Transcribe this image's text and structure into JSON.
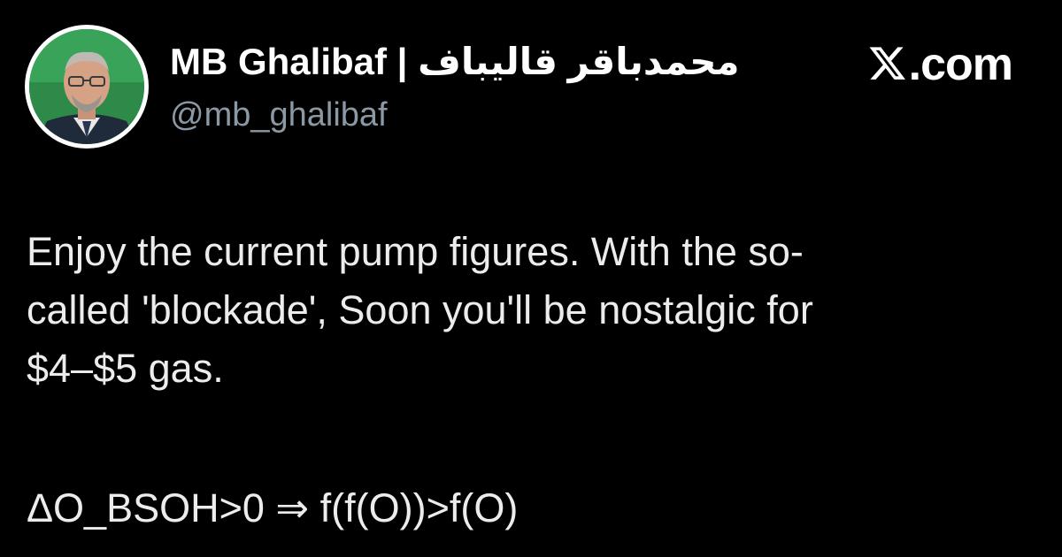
{
  "author": {
    "display_name": "MB Ghalibaf | محمدباقر قالیباف",
    "handle": "@mb_ghalibaf",
    "avatar_icon": "profile-photo"
  },
  "brand": {
    "icon": "x-logo-icon",
    "text": ".com"
  },
  "post": {
    "lines": [
      "Enjoy the current pump figures. With the so-",
      "called 'blockade', Soon you'll be nostalgic for",
      "$4–$5 gas."
    ],
    "formula": "ΔO_BSOH>0 ⇒ f(f(O))>f(O)"
  },
  "colors": {
    "background": "#000000",
    "text_primary": "#ffffff",
    "text_secondary": "#8b98a5",
    "avatar_backdrop": "#2e8a48"
  }
}
